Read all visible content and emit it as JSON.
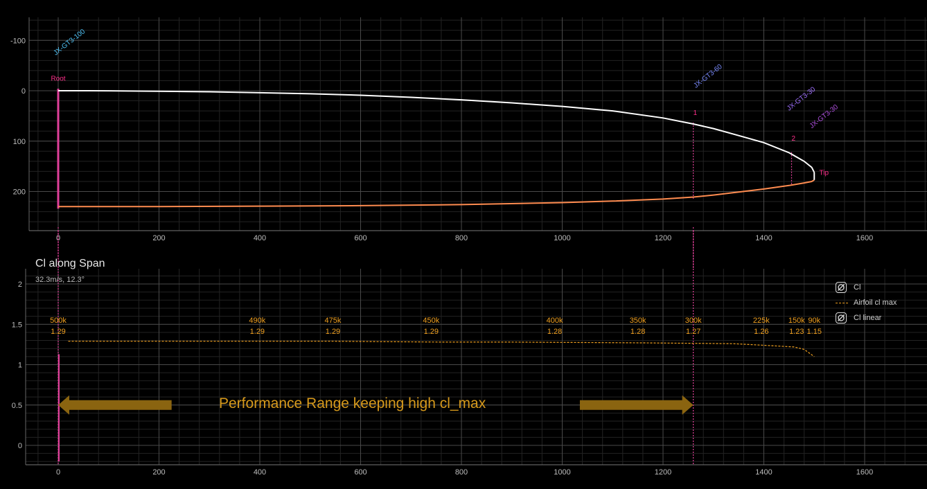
{
  "chart_data": [
    {
      "type": "line",
      "x_ticks": [
        0,
        200,
        400,
        600,
        800,
        1000,
        1200,
        1400,
        1600
      ],
      "y_ticks": [
        -100,
        0,
        100,
        200
      ],
      "xlim": [
        -60,
        1720
      ],
      "ylim": [
        -145,
        275
      ],
      "y_reversed": true,
      "grid": true,
      "series": [
        {
          "color": "#ffffff",
          "x": [
            0,
            100,
            200,
            300,
            400,
            500,
            600,
            700,
            800,
            900,
            1000,
            1100,
            1200,
            1260,
            1300,
            1350,
            1400,
            1450,
            1480,
            1495,
            1500
          ],
          "y": [
            0,
            0.2,
            1,
            2,
            4,
            6,
            9,
            13,
            18,
            24,
            31,
            40,
            54,
            66,
            75,
            89,
            103,
            123,
            140,
            152,
            162
          ]
        },
        {
          "color": "#ff8c50",
          "x": [
            0,
            200,
            400,
            600,
            800,
            1000,
            1100,
            1200,
            1260,
            1300,
            1350,
            1400,
            1450,
            1480,
            1495,
            1500
          ],
          "y": [
            230,
            230,
            229,
            228,
            226,
            222,
            219,
            215,
            211,
            207,
            201,
            195,
            188,
            183,
            180,
            177
          ]
        }
      ],
      "labels": [
        {
          "text": "Root",
          "x": 0,
          "y": -20,
          "color": "#ff2e8a"
        },
        {
          "text": "Tip",
          "x": 1510,
          "y": 167,
          "color": "#ff2e8a"
        },
        {
          "text": "1",
          "x": 1260,
          "y": 48,
          "color": "#ff2e8a"
        },
        {
          "text": "2",
          "x": 1455,
          "y": 99,
          "color": "#ff2e8a"
        }
      ],
      "airfoils": [
        {
          "text": "JX-GT3-100",
          "x": -5,
          "y": -70,
          "color": "#4fc3f7"
        },
        {
          "text": "JX-GT3-60",
          "x": 1265,
          "y": -5,
          "color": "#7b8cff"
        },
        {
          "text": "JX-GT3-30",
          "x": 1450,
          "y": 40,
          "color": "#a070ff"
        },
        {
          "text": "JX-GT3-30",
          "x": 1495,
          "y": 75,
          "color": "#b050e0"
        }
      ],
      "markers": [
        {
          "x": 1260,
          "y_from": 63,
          "y_to": 215
        },
        {
          "x": 1455,
          "y_from": 122,
          "y_to": 188
        }
      ]
    },
    {
      "type": "line",
      "title": "Cl along Span",
      "subtitle": "32.3m/s, 12.3°",
      "x_ticks": [
        0,
        200,
        400,
        600,
        800,
        1000,
        1200,
        1400,
        1600
      ],
      "y_ticks": [
        0,
        0.5,
        1,
        1.5,
        2
      ],
      "y_tick_labels": [
        "0",
        "0.5",
        "1",
        "1.5",
        "2"
      ],
      "xlim": [
        -65,
        1720
      ],
      "ylim": [
        -0.23,
        2.17
      ],
      "grid": true,
      "legend_position": "top-right",
      "legend": [
        {
          "name": "Cl",
          "style": "icon"
        },
        {
          "name": "Airfoil cl max",
          "style": "dash",
          "color": "#f0a020"
        },
        {
          "name": "Cl linear",
          "style": "icon"
        }
      ],
      "series": [
        {
          "name": "Airfoil cl max",
          "color": "#f0a020",
          "dashed": true,
          "x": [
            20,
            200,
            400,
            550,
            760,
            900,
            1160,
            1340,
            1400,
            1460,
            1480,
            1500
          ],
          "y": [
            1.29,
            1.29,
            1.29,
            1.29,
            1.28,
            1.28,
            1.27,
            1.26,
            1.24,
            1.22,
            1.19,
            1.1
          ]
        }
      ],
      "data_labels": [
        {
          "re": "500k",
          "cl": "1.29",
          "x": 0
        },
        {
          "re": "490k",
          "cl": "1.29",
          "x": 395
        },
        {
          "re": "475k",
          "cl": "1.29",
          "x": 545
        },
        {
          "re": "450k",
          "cl": "1.29",
          "x": 740
        },
        {
          "re": "400k",
          "cl": "1.28",
          "x": 985
        },
        {
          "re": "350k",
          "cl": "1.28",
          "x": 1150
        },
        {
          "re": "300k",
          "cl": "1.27",
          "x": 1260
        },
        {
          "re": "225k",
          "cl": "1.26",
          "x": 1395
        },
        {
          "re": "150k",
          "cl": "1.23",
          "x": 1465
        },
        {
          "re": "90k",
          "cl": "1.15",
          "x": 1500
        }
      ],
      "annotation": "Performance Range keeping high cl_max",
      "range_arrows": [
        {
          "direction": "left",
          "x_from": 0,
          "x_to": 225
        },
        {
          "direction": "right",
          "x_from": 1035,
          "x_to": 1260
        }
      ],
      "markers": [
        {
          "x": 0
        },
        {
          "x": 1260
        }
      ]
    }
  ],
  "colors": {
    "grid_major": "#4a4a4a",
    "grid_minor": "#232323",
    "marker": "#e0409a",
    "arrow": "#8a6410"
  }
}
